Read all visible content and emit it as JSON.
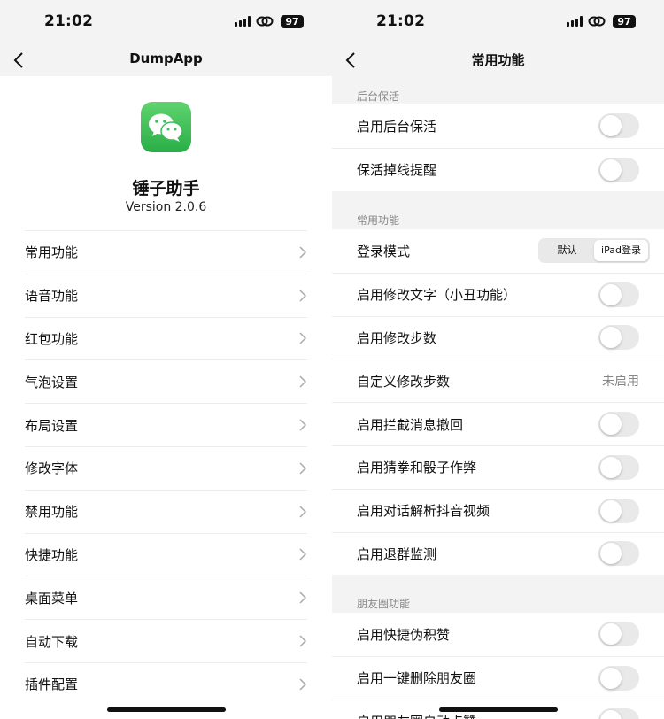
{
  "left": {
    "status": {
      "time": "21:02",
      "battery": "97"
    },
    "nav": {
      "title": "DumpApp"
    },
    "app": {
      "name": "锤子助手",
      "version": "Version 2.0.6"
    },
    "menu": [
      {
        "label": "常用功能"
      },
      {
        "label": "语音功能"
      },
      {
        "label": "红包功能"
      },
      {
        "label": "气泡设置"
      },
      {
        "label": "布局设置"
      },
      {
        "label": "修改字体"
      },
      {
        "label": "禁用功能"
      },
      {
        "label": "快捷功能"
      },
      {
        "label": "桌面菜单"
      },
      {
        "label": "自动下载"
      },
      {
        "label": "插件配置"
      }
    ]
  },
  "right": {
    "status": {
      "time": "21:02",
      "battery": "97"
    },
    "nav": {
      "title": "常用功能"
    },
    "sections": [
      {
        "header": "后台保活",
        "rows": [
          {
            "label": "启用后台保活",
            "control": "toggle",
            "on": false
          },
          {
            "label": "保活掉线提醒",
            "control": "toggle",
            "on": false
          }
        ]
      },
      {
        "header": "常用功能",
        "rows": [
          {
            "label": "登录模式",
            "control": "segmented",
            "options": [
              "默认",
              "iPad登录"
            ],
            "selected": "iPad登录"
          },
          {
            "label": "启用修改文字（小丑功能）",
            "control": "toggle",
            "on": false
          },
          {
            "label": "启用修改步数",
            "control": "toggle",
            "on": false
          },
          {
            "label": "自定义修改步数",
            "control": "value",
            "value": "未启用"
          },
          {
            "label": "启用拦截消息撤回",
            "control": "toggle",
            "on": false
          },
          {
            "label": "启用猜拳和骰子作弊",
            "control": "toggle",
            "on": false
          },
          {
            "label": "启用对话解析抖音视频",
            "control": "toggle",
            "on": false
          },
          {
            "label": "启用退群监测",
            "control": "toggle",
            "on": false
          }
        ]
      },
      {
        "header": "朋友圈功能",
        "rows": [
          {
            "label": "启用快捷伪积赞",
            "control": "toggle",
            "on": false
          },
          {
            "label": "启用一键删除朋友圈",
            "control": "toggle",
            "on": false
          },
          {
            "label": "启用朋友圈自动点赞",
            "control": "toggle",
            "on": false
          }
        ]
      }
    ]
  }
}
